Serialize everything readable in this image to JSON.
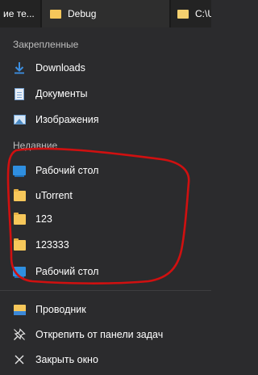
{
  "taskbar": {
    "tabs": [
      {
        "label": "ие те...",
        "icon": "none"
      },
      {
        "label": "Debug",
        "icon": "folder-icon"
      },
      {
        "label": "C:\\U",
        "icon": "folder-icon"
      }
    ]
  },
  "pinned": {
    "title": "Закрепленные",
    "items": [
      {
        "label": "Downloads",
        "icon": "download-arrow-icon"
      },
      {
        "label": "Документы",
        "icon": "document-icon"
      },
      {
        "label": "Изображения",
        "icon": "pictures-icon"
      }
    ]
  },
  "recent": {
    "title": "Недавние",
    "items": [
      {
        "label": "Рабочий стол",
        "icon": "desktop-icon"
      },
      {
        "label": "uTorrent",
        "icon": "folder-icon"
      },
      {
        "label": "123",
        "icon": "folder-icon"
      },
      {
        "label": "123333",
        "icon": "folder-icon"
      },
      {
        "label": "Рабочий стол",
        "icon": "desktop-icon"
      }
    ]
  },
  "actions": {
    "items": [
      {
        "label": "Проводник",
        "icon": "file-explorer-icon"
      },
      {
        "label": "Открепить от панели задач",
        "icon": "unpin-icon"
      },
      {
        "label": "Закрыть окно",
        "icon": "close-icon"
      }
    ]
  },
  "colors": {
    "background": "#2b2b2d",
    "annotation": "#d01010",
    "folder": "#f6c75a",
    "accent_blue": "#2f8fe0"
  }
}
